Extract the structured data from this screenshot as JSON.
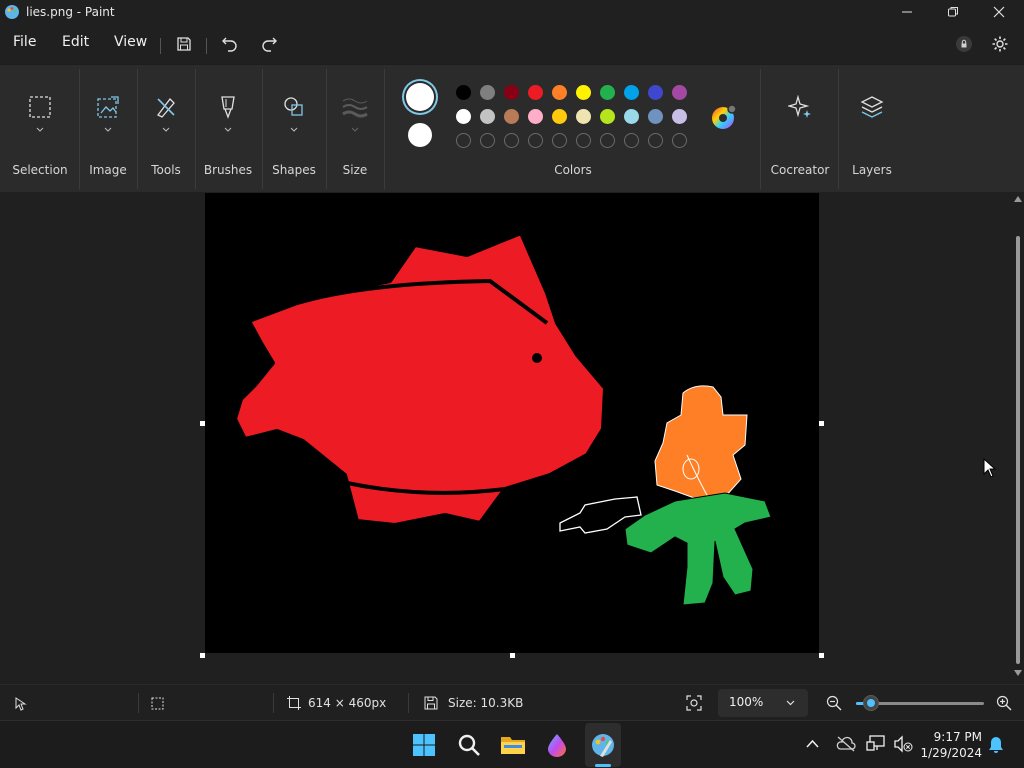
{
  "window": {
    "title": "lies.png - Paint"
  },
  "menu": {
    "file": "File",
    "edit": "Edit",
    "view": "View"
  },
  "ribbon": {
    "groups": {
      "selection": "Selection",
      "image": "Image",
      "tools": "Tools",
      "brushes": "Brushes",
      "shapes": "Shapes",
      "size": "Size",
      "colors": "Colors",
      "cocreator": "Cocreator",
      "layers": "Layers"
    },
    "palette": {
      "row1": [
        "#000000",
        "#7f7f7f",
        "#880015",
        "#ed1c24",
        "#ff7f27",
        "#fff200",
        "#22b14c",
        "#00a2e8",
        "#3f48cc",
        "#a349a4"
      ],
      "row2": [
        "#ffffff",
        "#c3c3c3",
        "#b97a57",
        "#ffaec9",
        "#ffc90e",
        "#efe4b0",
        "#b5e61d",
        "#99d9ea",
        "#7092be",
        "#c8bfe7"
      ],
      "row3_empty_count": 10,
      "color1": "#ffffff",
      "color2": "#ffffff"
    }
  },
  "status": {
    "canvas_size": "614 × 460px",
    "file_size": "Size: 10.3KB",
    "zoom": "100%",
    "zoom_fraction": 0.12
  },
  "taskbar": {
    "time": "9:17 PM",
    "date": "1/29/2024"
  },
  "colors": {
    "accent": "#4cc2ff",
    "fish": "#ed1c24",
    "flower": "#ff7f27",
    "stem": "#22b14c"
  }
}
